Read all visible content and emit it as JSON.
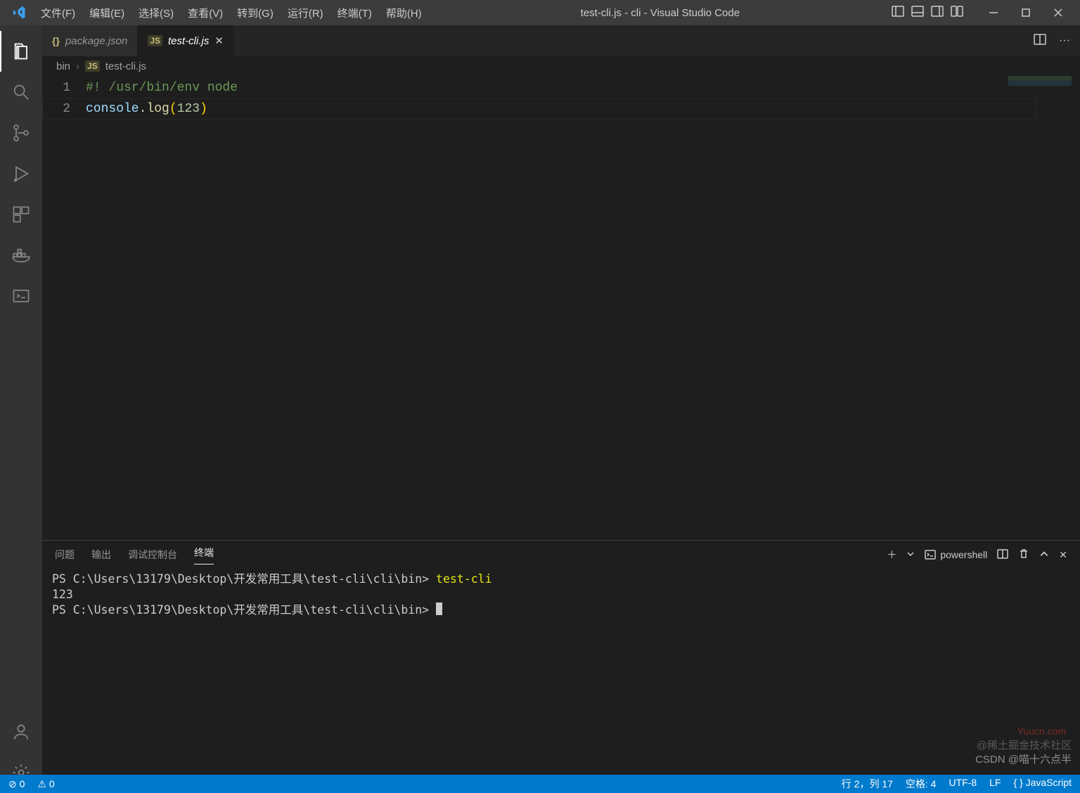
{
  "title": "test-cli.js - cli - Visual Studio Code",
  "menu": [
    "文件(F)",
    "编辑(E)",
    "选择(S)",
    "查看(V)",
    "转到(G)",
    "运行(R)",
    "终端(T)",
    "帮助(H)"
  ],
  "tabs": [
    {
      "label": "package.json",
      "icon": "{}"
    },
    {
      "label": "test-cli.js",
      "icon": "JS"
    }
  ],
  "breadcrumb": {
    "dir": "bin",
    "file": "test-cli.js",
    "icon": "JS"
  },
  "editor": {
    "lines": [
      "1",
      "2"
    ],
    "l1": "#! /usr/bin/env node",
    "l2_obj": "console",
    "l2_dot": ".",
    "l2_method": "log",
    "l2_open": "(",
    "l2_num": "123",
    "l2_close": ")"
  },
  "panel": {
    "tabs": [
      "问题",
      "输出",
      "调试控制台",
      "终端"
    ],
    "shell": "powershell",
    "term_prompt1": "PS C:\\Users\\13179\\Desktop\\开发常用工具\\test-cli\\cli\\bin> ",
    "term_cmd": "test-cli",
    "term_out": "123",
    "term_prompt2": "PS C:\\Users\\13179\\Desktop\\开发常用工具\\test-cli\\cli\\bin> "
  },
  "status": {
    "left1": "⊘ 0",
    "left2": "⚠ 0",
    "right": [
      "行 2，列 17",
      "空格: 4",
      "UTF-8",
      "LF",
      "{ } JavaScript"
    ]
  },
  "watermarks": {
    "a": "@稀土掘金技术社区",
    "b": "CSDN @喵十六点半",
    "c": "Yuucn.com"
  }
}
